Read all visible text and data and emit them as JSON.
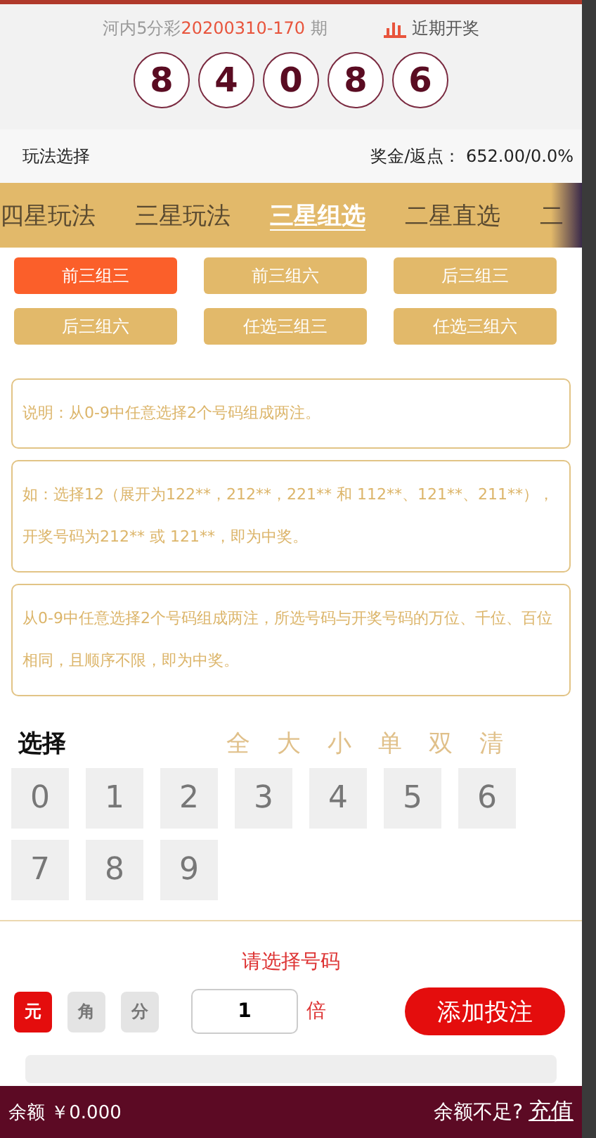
{
  "draw": {
    "lottery": "河内5分彩",
    "issue": "20200310-170",
    "suffix": "期",
    "history_link": "近期开奖",
    "balls": [
      "8",
      "4",
      "0",
      "8",
      "6"
    ]
  },
  "play_bar": {
    "label": "玩法选择",
    "odds_label": "奖金/返点：",
    "odds_value": "652.00/0.0%"
  },
  "tabs": [
    {
      "label": "四星玩法",
      "selected": false
    },
    {
      "label": "三星玩法",
      "selected": false
    },
    {
      "label": "三星组选",
      "selected": true
    },
    {
      "label": "二星直选",
      "selected": false
    },
    {
      "label": "二",
      "selected": false
    }
  ],
  "sub_modes": [
    {
      "label": "前三组三",
      "selected": true
    },
    {
      "label": "前三组六",
      "selected": false
    },
    {
      "label": "后三组三",
      "selected": false
    },
    {
      "label": "后三组六",
      "selected": false
    },
    {
      "label": "任选三组三",
      "selected": false
    },
    {
      "label": "任选三组六",
      "selected": false
    }
  ],
  "notes": [
    "说明：从0-9中任意选择2个号码组成两注。",
    "如：选择12（展开为122**，212**，221** 和 112**、121**、211**），开奖号码为212** 或 121**，即为中奖。",
    "从0-9中任意选择2个号码组成两注，所选号码与开奖号码的万位、千位、百位相同，且顺序不限，即为中奖。"
  ],
  "picker": {
    "title": "选择",
    "quick": [
      "全",
      "大",
      "小",
      "单",
      "双",
      "清"
    ],
    "numbers": [
      {
        "label": "0",
        "selected": false
      },
      {
        "label": "1",
        "selected": false
      },
      {
        "label": "2",
        "selected": false
      },
      {
        "label": "3",
        "selected": false
      },
      {
        "label": "4",
        "selected": false
      },
      {
        "label": "5",
        "selected": false
      },
      {
        "label": "6",
        "selected": false
      },
      {
        "label": "7",
        "selected": false
      },
      {
        "label": "8",
        "selected": false
      },
      {
        "label": "9",
        "selected": false
      }
    ]
  },
  "bet": {
    "hint": "请选择号码",
    "units": [
      {
        "label": "元",
        "selected": true
      },
      {
        "label": "角",
        "selected": false
      },
      {
        "label": "分",
        "selected": false
      }
    ],
    "multiplier": "1",
    "multiplier_unit": "倍",
    "add_button": "添加投注"
  },
  "footer": {
    "balance_label": "余额",
    "balance": "￥0.000",
    "low_text": "余额不足?",
    "recharge": "充值"
  }
}
